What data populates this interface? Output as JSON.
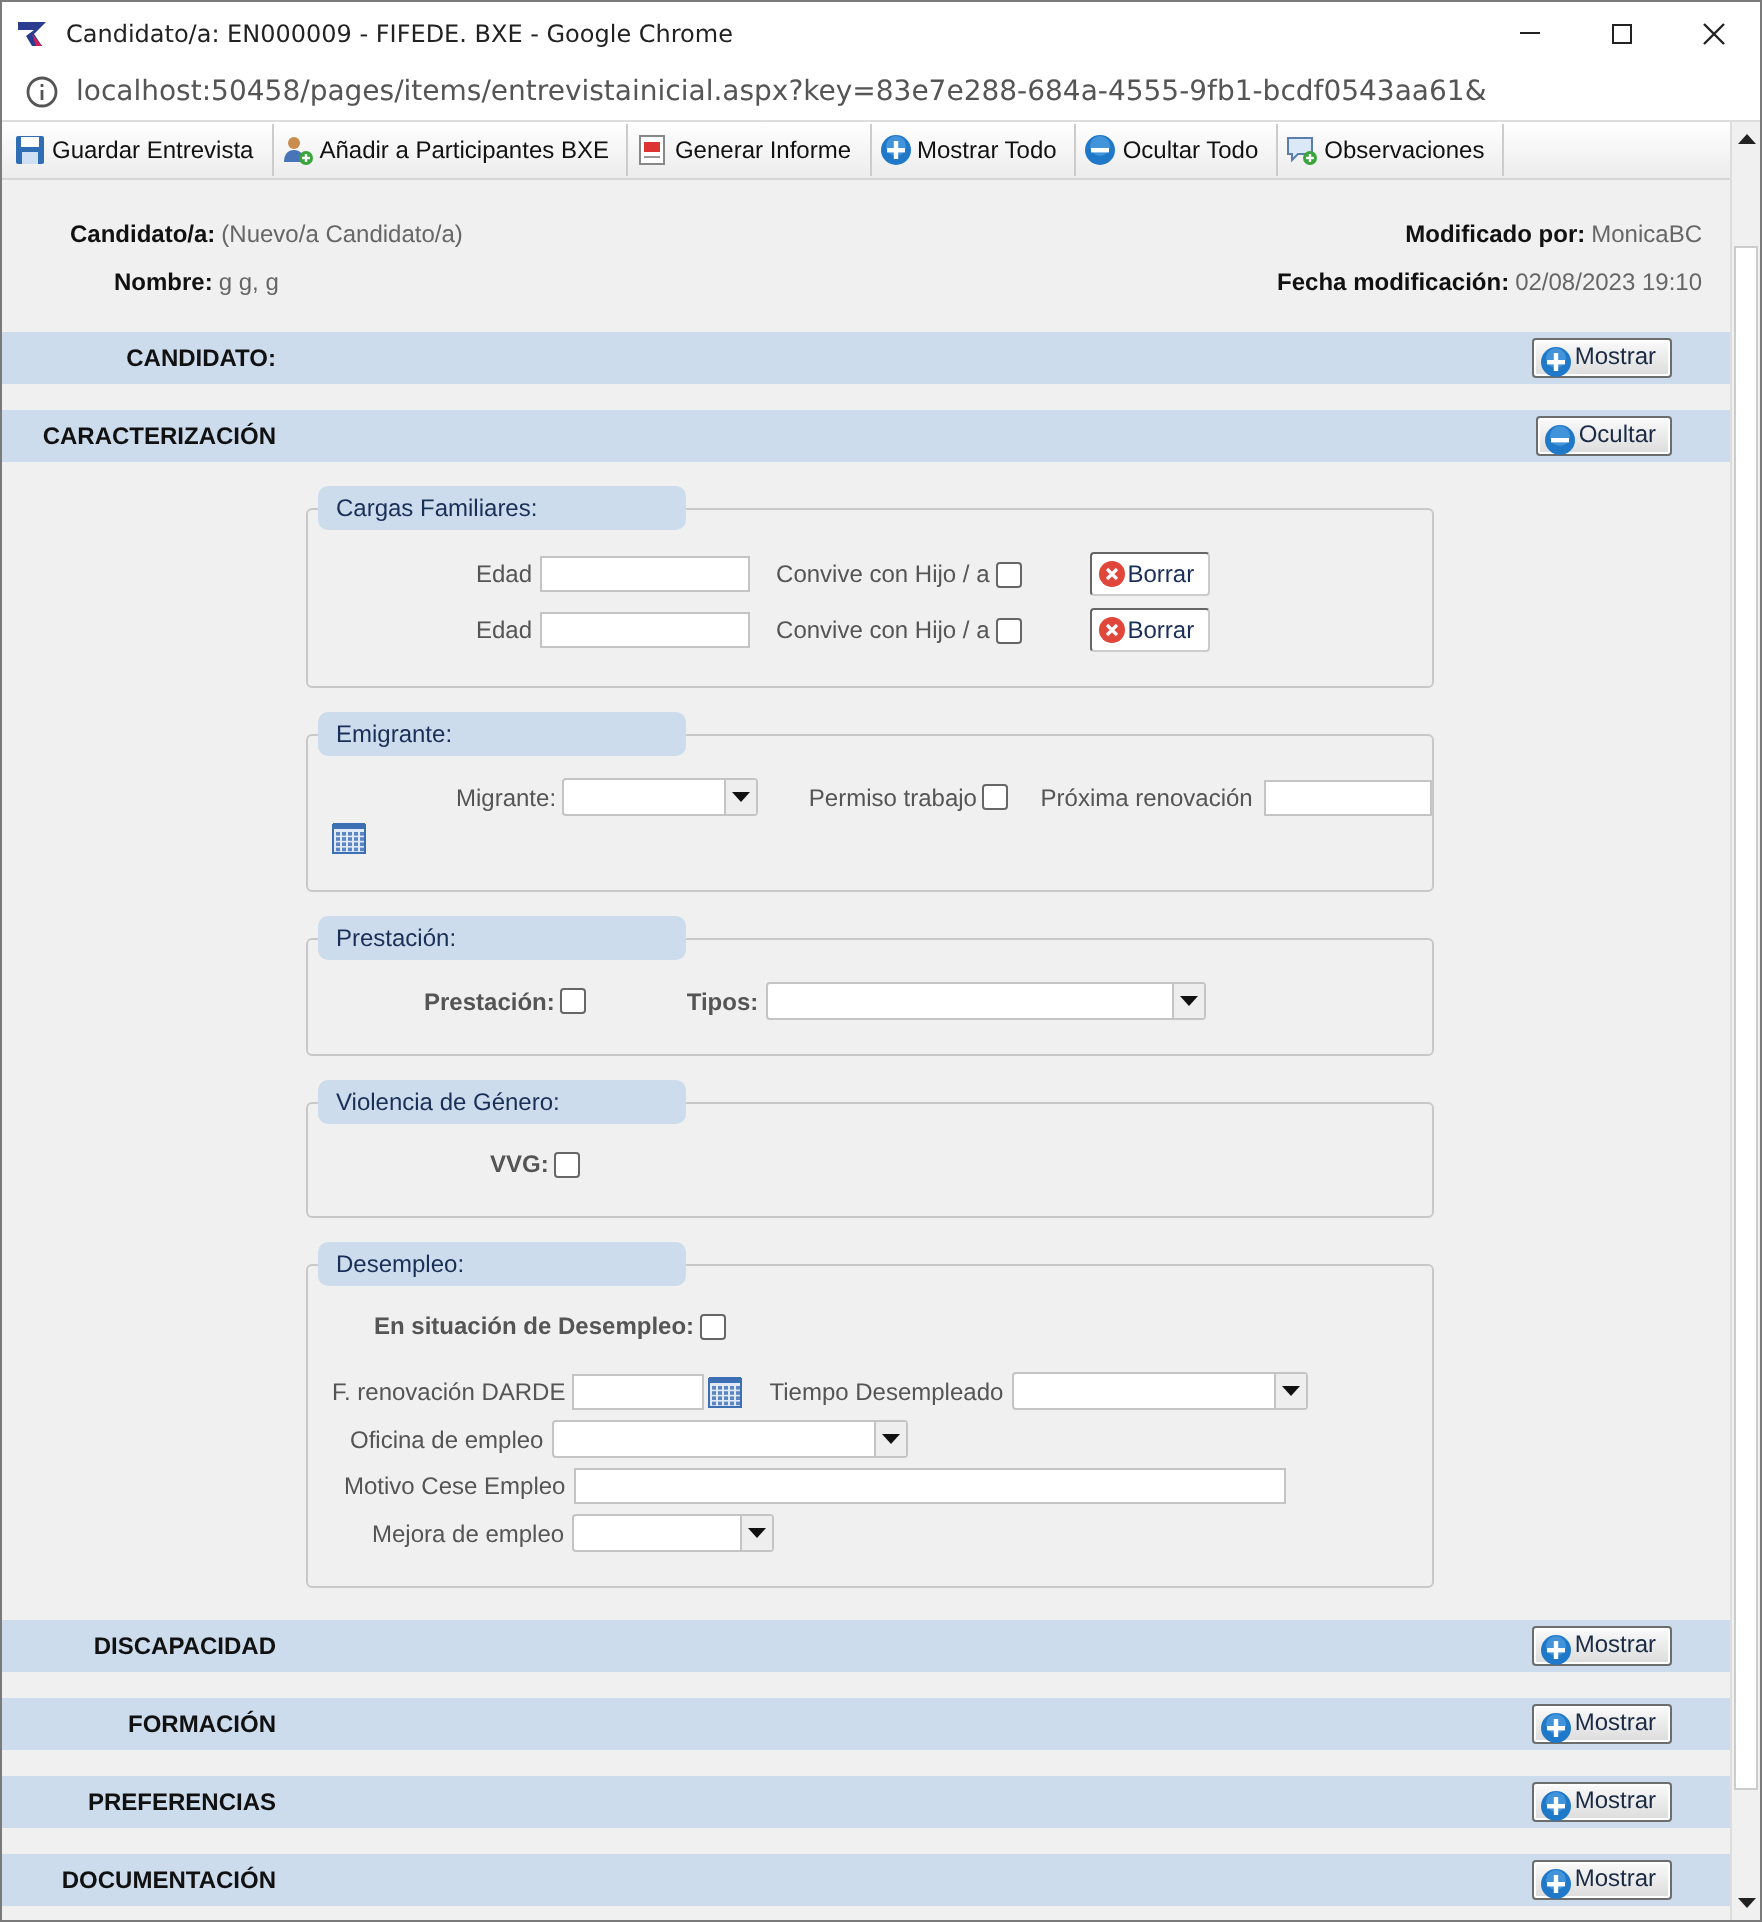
{
  "window": {
    "title": "Candidato/a: EN000009 - FIFEDE. BXE - Google Chrome",
    "url": "localhost:50458/pages/items/entrevistainicial.aspx?key=83e7e288-684a-4555-9fb1-bcdf0543aa61&"
  },
  "toolbar": [
    {
      "label": "Guardar Entrevista",
      "kind": "save"
    },
    {
      "label": "Añadir a Participantes BXE",
      "kind": "user-add"
    },
    {
      "label": "Generar Informe",
      "kind": "document"
    },
    {
      "label": "Mostrar Todo",
      "kind": "plus"
    },
    {
      "label": "Ocultar Todo",
      "kind": "minus"
    },
    {
      "label": "Observaciones",
      "kind": "comment"
    }
  ],
  "header": {
    "left": [
      {
        "label": "Candidato/a:",
        "value": "(Nuevo/a Candidato/a)"
      },
      {
        "label": "Nombre:",
        "value": "g g, g"
      }
    ],
    "right": [
      {
        "label": "Modificado por:",
        "value": "MonicaBC"
      },
      {
        "label": "Fecha modificación:",
        "value": "02/08/2023 19:10"
      }
    ]
  },
  "sections": [
    {
      "title": "CANDIDATO:",
      "expanded": false,
      "button": "Mostrar"
    },
    {
      "title": "CARACTERIZACIÓN",
      "expanded": true,
      "button": "Ocultar",
      "groups": [
        {
          "legend": "Cargas Familiares:",
          "rows": [
            [
              {
                "kind": "label",
                "text": "Edad"
              },
              {
                "kind": "input"
              },
              {
                "kind": "label",
                "text": "Convive con Hijo / a"
              },
              {
                "kind": "checkbox",
                "checked": false
              },
              {
                "kind": "delete",
                "text": "Borrar"
              }
            ],
            [
              {
                "kind": "label",
                "text": "Edad"
              },
              {
                "kind": "input"
              },
              {
                "kind": "label",
                "text": "Convive con Hijo / a"
              },
              {
                "kind": "checkbox",
                "checked": false
              },
              {
                "kind": "delete",
                "text": "Borrar"
              }
            ]
          ]
        },
        {
          "legend": "Emigrante:",
          "rows": [
            [
              {
                "kind": "label",
                "text": "Migrante:"
              },
              {
                "kind": "select"
              },
              {
                "kind": "label",
                "text": "Permiso trabajo"
              },
              {
                "kind": "checkbox",
                "checked": false
              },
              {
                "kind": "label",
                "text": "Próxima renovación"
              },
              {
                "kind": "input"
              }
            ],
            [
              {
                "kind": "calendar"
              }
            ]
          ]
        },
        {
          "legend": "Prestación:",
          "rows": [
            [
              {
                "kind": "strong",
                "text": "Prestación:"
              },
              {
                "kind": "checkbox",
                "checked": false
              },
              {
                "kind": "strong",
                "text": "Tipos:"
              },
              {
                "kind": "select"
              }
            ]
          ]
        },
        {
          "legend": "Violencia de Género:",
          "rows": [
            [
              {
                "kind": "strong",
                "text": "VVG:"
              },
              {
                "kind": "checkbox",
                "checked": false
              }
            ]
          ]
        },
        {
          "legend": "Desempleo:",
          "rows": [
            [
              {
                "kind": "strong",
                "text": "En situación de Desempleo:"
              },
              {
                "kind": "checkbox",
                "checked": false
              }
            ],
            [
              {
                "kind": "label",
                "text": "F. renovación DARDE"
              },
              {
                "kind": "input"
              },
              {
                "kind": "calendar"
              },
              {
                "kind": "label",
                "text": "Tiempo Desempleado"
              },
              {
                "kind": "select"
              }
            ],
            [
              {
                "kind": "label",
                "text": "Oficina de empleo"
              },
              {
                "kind": "select"
              }
            ],
            [
              {
                "kind": "label",
                "text": "Motivo Cese Empleo"
              },
              {
                "kind": "input"
              }
            ],
            [
              {
                "kind": "label",
                "text": "Mejora de empleo"
              },
              {
                "kind": "select"
              }
            ]
          ]
        }
      ]
    },
    {
      "title": "DISCAPACIDAD",
      "expanded": false,
      "button": "Mostrar"
    },
    {
      "title": "FORMACIÓN",
      "expanded": false,
      "button": "Mostrar"
    },
    {
      "title": "PREFERENCIAS",
      "expanded": false,
      "button": "Mostrar"
    },
    {
      "title": "DOCUMENTACIÓN",
      "expanded": false,
      "button": "Mostrar"
    }
  ]
}
